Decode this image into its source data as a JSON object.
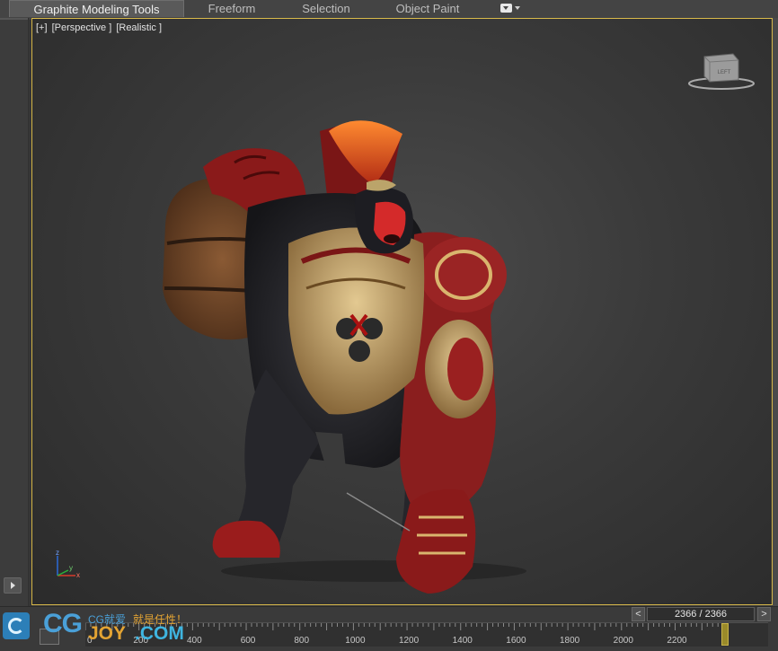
{
  "ribbon": {
    "tabs": [
      {
        "label": "Graphite Modeling Tools",
        "active": true
      },
      {
        "label": "Freeform",
        "active": false
      },
      {
        "label": "Selection",
        "active": false
      },
      {
        "label": "Object Paint",
        "active": false
      }
    ],
    "dropdown_icon": "ribbon-options-dropdown-icon"
  },
  "viewport": {
    "label_parts": [
      "[+]",
      "[Perspective ]",
      "[Realistic ]"
    ],
    "viewcube_face": "LEFT",
    "axis_labels": {
      "z": "z",
      "x": "x",
      "y": "y"
    },
    "border_color": "#d8b94a"
  },
  "timeline": {
    "frame_display": "2366 / 2366",
    "prev_label": "<",
    "next_label": ">",
    "ticks": [
      "0",
      "200",
      "400",
      "600",
      "800",
      "1000",
      "1200",
      "1400",
      "1600",
      "1800",
      "2000",
      "2200"
    ],
    "current_frame": 2366,
    "max_frame": 2366
  },
  "watermark": {
    "cg": "CG",
    "joy": "JOY",
    "com": ".COM",
    "slogan_part1": "CG就爱",
    "slogan_part2": "就是任性！"
  },
  "colors": {
    "active_border": "#d8b94a",
    "slider": "#9a8a2a",
    "brand_blue": "#4aa0d8",
    "brand_orange": "#e4a433"
  }
}
